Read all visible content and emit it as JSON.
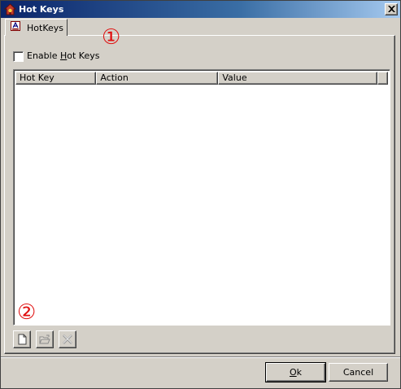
{
  "window": {
    "title": "Hot Keys"
  },
  "tabs": [
    {
      "label": "HotKeys",
      "selected": true
    }
  ],
  "annotations": {
    "marker_1": "①",
    "marker_2": "②"
  },
  "options": {
    "enable_hotkeys_label": "Enable Hot Keys",
    "enable_hotkeys_checked": false
  },
  "list": {
    "columns": [
      "Hot Key",
      "Action",
      "Value"
    ],
    "rows": []
  },
  "toolbar": {
    "new_icon": "new-document-icon",
    "open_icon": "open-folder-icon",
    "delete_icon": "delete-icon"
  },
  "buttons": {
    "ok_label": "Ok",
    "cancel_label": "Cancel"
  },
  "colors": {
    "titlebar_start": "#0a246a",
    "titlebar_end": "#a6caf0",
    "face": "#d4d0c8",
    "annotation": "#e01010"
  }
}
